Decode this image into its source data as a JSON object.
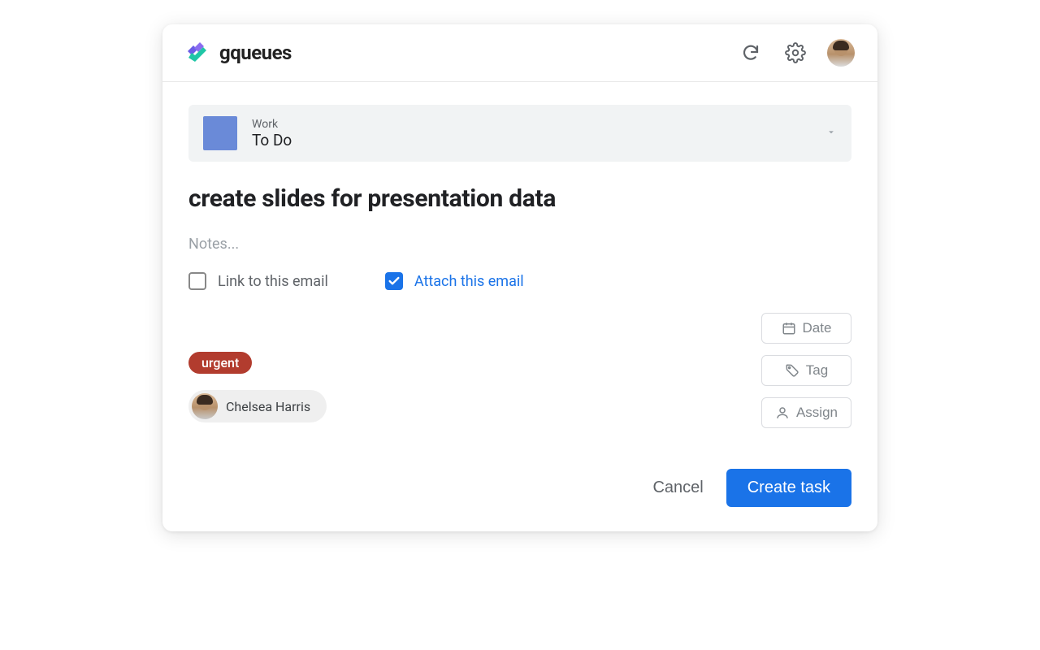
{
  "header": {
    "app_name": "gqueues"
  },
  "queue": {
    "category": "Work",
    "name": "To Do",
    "swatch_color": "#6a8ad8"
  },
  "task": {
    "title": "create slides for presentation data",
    "notes_placeholder": "Notes..."
  },
  "email_options": {
    "link_label": "Link to this email",
    "link_checked": false,
    "attach_label": "Attach this email",
    "attach_checked": true
  },
  "tags": [
    {
      "label": "urgent",
      "color": "#b23c2e"
    }
  ],
  "assignee": {
    "name": "Chelsea Harris"
  },
  "action_buttons": {
    "date": "Date",
    "tag": "Tag",
    "assign": "Assign"
  },
  "footer": {
    "cancel": "Cancel",
    "create": "Create task"
  }
}
